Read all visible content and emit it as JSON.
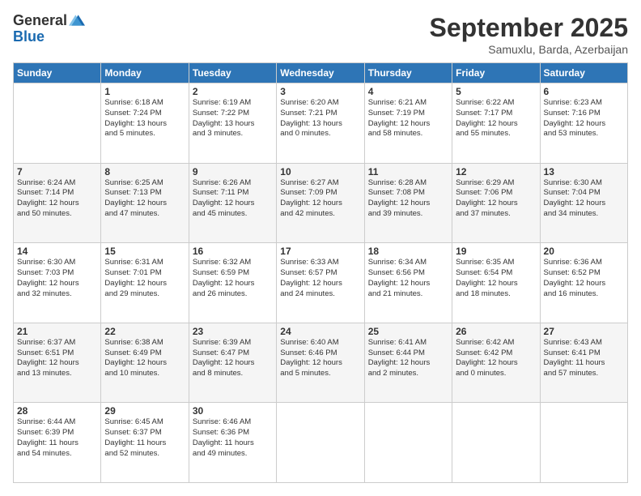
{
  "logo": {
    "general": "General",
    "blue": "Blue"
  },
  "header": {
    "month": "September 2025",
    "location": "Samuxlu, Barda, Azerbaijan"
  },
  "weekdays": [
    "Sunday",
    "Monday",
    "Tuesday",
    "Wednesday",
    "Thursday",
    "Friday",
    "Saturday"
  ],
  "weeks": [
    [
      {
        "day": "",
        "info": ""
      },
      {
        "day": "1",
        "info": "Sunrise: 6:18 AM\nSunset: 7:24 PM\nDaylight: 13 hours\nand 5 minutes."
      },
      {
        "day": "2",
        "info": "Sunrise: 6:19 AM\nSunset: 7:22 PM\nDaylight: 13 hours\nand 3 minutes."
      },
      {
        "day": "3",
        "info": "Sunrise: 6:20 AM\nSunset: 7:21 PM\nDaylight: 13 hours\nand 0 minutes."
      },
      {
        "day": "4",
        "info": "Sunrise: 6:21 AM\nSunset: 7:19 PM\nDaylight: 12 hours\nand 58 minutes."
      },
      {
        "day": "5",
        "info": "Sunrise: 6:22 AM\nSunset: 7:17 PM\nDaylight: 12 hours\nand 55 minutes."
      },
      {
        "day": "6",
        "info": "Sunrise: 6:23 AM\nSunset: 7:16 PM\nDaylight: 12 hours\nand 53 minutes."
      }
    ],
    [
      {
        "day": "7",
        "info": "Sunrise: 6:24 AM\nSunset: 7:14 PM\nDaylight: 12 hours\nand 50 minutes."
      },
      {
        "day": "8",
        "info": "Sunrise: 6:25 AM\nSunset: 7:13 PM\nDaylight: 12 hours\nand 47 minutes."
      },
      {
        "day": "9",
        "info": "Sunrise: 6:26 AM\nSunset: 7:11 PM\nDaylight: 12 hours\nand 45 minutes."
      },
      {
        "day": "10",
        "info": "Sunrise: 6:27 AM\nSunset: 7:09 PM\nDaylight: 12 hours\nand 42 minutes."
      },
      {
        "day": "11",
        "info": "Sunrise: 6:28 AM\nSunset: 7:08 PM\nDaylight: 12 hours\nand 39 minutes."
      },
      {
        "day": "12",
        "info": "Sunrise: 6:29 AM\nSunset: 7:06 PM\nDaylight: 12 hours\nand 37 minutes."
      },
      {
        "day": "13",
        "info": "Sunrise: 6:30 AM\nSunset: 7:04 PM\nDaylight: 12 hours\nand 34 minutes."
      }
    ],
    [
      {
        "day": "14",
        "info": "Sunrise: 6:30 AM\nSunset: 7:03 PM\nDaylight: 12 hours\nand 32 minutes."
      },
      {
        "day": "15",
        "info": "Sunrise: 6:31 AM\nSunset: 7:01 PM\nDaylight: 12 hours\nand 29 minutes."
      },
      {
        "day": "16",
        "info": "Sunrise: 6:32 AM\nSunset: 6:59 PM\nDaylight: 12 hours\nand 26 minutes."
      },
      {
        "day": "17",
        "info": "Sunrise: 6:33 AM\nSunset: 6:57 PM\nDaylight: 12 hours\nand 24 minutes."
      },
      {
        "day": "18",
        "info": "Sunrise: 6:34 AM\nSunset: 6:56 PM\nDaylight: 12 hours\nand 21 minutes."
      },
      {
        "day": "19",
        "info": "Sunrise: 6:35 AM\nSunset: 6:54 PM\nDaylight: 12 hours\nand 18 minutes."
      },
      {
        "day": "20",
        "info": "Sunrise: 6:36 AM\nSunset: 6:52 PM\nDaylight: 12 hours\nand 16 minutes."
      }
    ],
    [
      {
        "day": "21",
        "info": "Sunrise: 6:37 AM\nSunset: 6:51 PM\nDaylight: 12 hours\nand 13 minutes."
      },
      {
        "day": "22",
        "info": "Sunrise: 6:38 AM\nSunset: 6:49 PM\nDaylight: 12 hours\nand 10 minutes."
      },
      {
        "day": "23",
        "info": "Sunrise: 6:39 AM\nSunset: 6:47 PM\nDaylight: 12 hours\nand 8 minutes."
      },
      {
        "day": "24",
        "info": "Sunrise: 6:40 AM\nSunset: 6:46 PM\nDaylight: 12 hours\nand 5 minutes."
      },
      {
        "day": "25",
        "info": "Sunrise: 6:41 AM\nSunset: 6:44 PM\nDaylight: 12 hours\nand 2 minutes."
      },
      {
        "day": "26",
        "info": "Sunrise: 6:42 AM\nSunset: 6:42 PM\nDaylight: 12 hours\nand 0 minutes."
      },
      {
        "day": "27",
        "info": "Sunrise: 6:43 AM\nSunset: 6:41 PM\nDaylight: 11 hours\nand 57 minutes."
      }
    ],
    [
      {
        "day": "28",
        "info": "Sunrise: 6:44 AM\nSunset: 6:39 PM\nDaylight: 11 hours\nand 54 minutes."
      },
      {
        "day": "29",
        "info": "Sunrise: 6:45 AM\nSunset: 6:37 PM\nDaylight: 11 hours\nand 52 minutes."
      },
      {
        "day": "30",
        "info": "Sunrise: 6:46 AM\nSunset: 6:36 PM\nDaylight: 11 hours\nand 49 minutes."
      },
      {
        "day": "",
        "info": ""
      },
      {
        "day": "",
        "info": ""
      },
      {
        "day": "",
        "info": ""
      },
      {
        "day": "",
        "info": ""
      }
    ]
  ]
}
